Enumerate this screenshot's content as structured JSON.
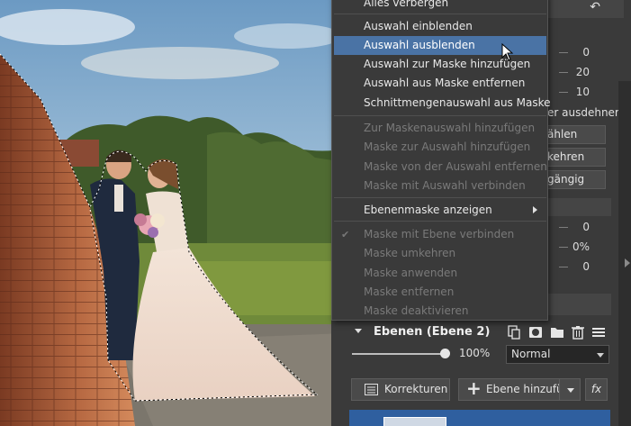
{
  "menu": {
    "items": [
      {
        "label": "Alles verbergen",
        "disabled": false
      },
      {
        "label": "Auswahl einblenden",
        "disabled": false
      },
      {
        "label": "Auswahl ausblenden",
        "disabled": false,
        "selected": true
      },
      {
        "label": "Auswahl zur Maske hinzufügen",
        "disabled": false
      },
      {
        "label": "Auswahl aus Maske entfernen",
        "disabled": false
      },
      {
        "label": "Schnittmengenauswahl aus Maske",
        "disabled": false
      },
      {
        "label": "Zur Maskenauswahl hinzufügen",
        "disabled": true
      },
      {
        "label": "Maske zur Auswahl hinzufügen",
        "disabled": true
      },
      {
        "label": "Maske von der Auswahl entfernen",
        "disabled": true
      },
      {
        "label": "Maske mit Auswahl verbinden",
        "disabled": true
      },
      {
        "label": "Ebenenmaske anzeigen",
        "disabled": false,
        "submenu": true
      },
      {
        "label": "Maske mit Ebene verbinden",
        "disabled": true,
        "checked": true
      },
      {
        "label": "Maske umkehren",
        "disabled": true
      },
      {
        "label": "Maske anwenden",
        "disabled": true
      },
      {
        "label": "Maske entfernen",
        "disabled": true
      },
      {
        "label": "Maske deaktivieren",
        "disabled": true
      }
    ]
  },
  "panel": {
    "values_top": [
      "0",
      "20",
      "10"
    ],
    "expand_label": "er ausdehner",
    "buttons": [
      "ählen",
      "kehren",
      "gängig"
    ],
    "values_mid": [
      "0",
      "0%",
      "0"
    ]
  },
  "layers": {
    "title": "Ebenen (Ebene 2)",
    "opacity": "100%",
    "opacity_level": 1.0,
    "blend_mode": "Normal",
    "corrections_label": "Korrekturen",
    "add_layer_label": "Ebene hinzufü",
    "fx_label": "fx"
  },
  "icons": {
    "undo": "undo-icon",
    "duplicate": "duplicate-layer-icon",
    "mask": "mask-icon",
    "folder": "folder-icon",
    "delete": "trash-icon",
    "menu": "hamburger-menu-icon"
  },
  "colors": {
    "selected": "#4a73a5",
    "panel": "#3a3a3a",
    "layer_active": "#2f5f9f"
  }
}
